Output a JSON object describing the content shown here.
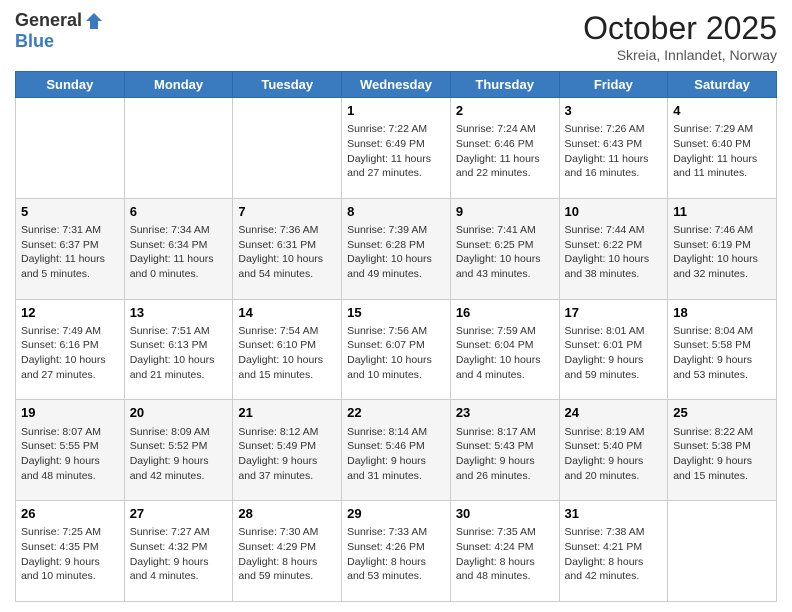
{
  "logo": {
    "general": "General",
    "blue": "Blue"
  },
  "header": {
    "month": "October 2025",
    "location": "Skreia, Innlandet, Norway"
  },
  "days": [
    "Sunday",
    "Monday",
    "Tuesday",
    "Wednesday",
    "Thursday",
    "Friday",
    "Saturday"
  ],
  "weeks": [
    [
      {
        "day": "",
        "info": ""
      },
      {
        "day": "",
        "info": ""
      },
      {
        "day": "",
        "info": ""
      },
      {
        "day": "1",
        "info": "Sunrise: 7:22 AM\nSunset: 6:49 PM\nDaylight: 11 hours and 27 minutes."
      },
      {
        "day": "2",
        "info": "Sunrise: 7:24 AM\nSunset: 6:46 PM\nDaylight: 11 hours and 22 minutes."
      },
      {
        "day": "3",
        "info": "Sunrise: 7:26 AM\nSunset: 6:43 PM\nDaylight: 11 hours and 16 minutes."
      },
      {
        "day": "4",
        "info": "Sunrise: 7:29 AM\nSunset: 6:40 PM\nDaylight: 11 hours and 11 minutes."
      }
    ],
    [
      {
        "day": "5",
        "info": "Sunrise: 7:31 AM\nSunset: 6:37 PM\nDaylight: 11 hours and 5 minutes."
      },
      {
        "day": "6",
        "info": "Sunrise: 7:34 AM\nSunset: 6:34 PM\nDaylight: 11 hours and 0 minutes."
      },
      {
        "day": "7",
        "info": "Sunrise: 7:36 AM\nSunset: 6:31 PM\nDaylight: 10 hours and 54 minutes."
      },
      {
        "day": "8",
        "info": "Sunrise: 7:39 AM\nSunset: 6:28 PM\nDaylight: 10 hours and 49 minutes."
      },
      {
        "day": "9",
        "info": "Sunrise: 7:41 AM\nSunset: 6:25 PM\nDaylight: 10 hours and 43 minutes."
      },
      {
        "day": "10",
        "info": "Sunrise: 7:44 AM\nSunset: 6:22 PM\nDaylight: 10 hours and 38 minutes."
      },
      {
        "day": "11",
        "info": "Sunrise: 7:46 AM\nSunset: 6:19 PM\nDaylight: 10 hours and 32 minutes."
      }
    ],
    [
      {
        "day": "12",
        "info": "Sunrise: 7:49 AM\nSunset: 6:16 PM\nDaylight: 10 hours and 27 minutes."
      },
      {
        "day": "13",
        "info": "Sunrise: 7:51 AM\nSunset: 6:13 PM\nDaylight: 10 hours and 21 minutes."
      },
      {
        "day": "14",
        "info": "Sunrise: 7:54 AM\nSunset: 6:10 PM\nDaylight: 10 hours and 15 minutes."
      },
      {
        "day": "15",
        "info": "Sunrise: 7:56 AM\nSunset: 6:07 PM\nDaylight: 10 hours and 10 minutes."
      },
      {
        "day": "16",
        "info": "Sunrise: 7:59 AM\nSunset: 6:04 PM\nDaylight: 10 hours and 4 minutes."
      },
      {
        "day": "17",
        "info": "Sunrise: 8:01 AM\nSunset: 6:01 PM\nDaylight: 9 hours and 59 minutes."
      },
      {
        "day": "18",
        "info": "Sunrise: 8:04 AM\nSunset: 5:58 PM\nDaylight: 9 hours and 53 minutes."
      }
    ],
    [
      {
        "day": "19",
        "info": "Sunrise: 8:07 AM\nSunset: 5:55 PM\nDaylight: 9 hours and 48 minutes."
      },
      {
        "day": "20",
        "info": "Sunrise: 8:09 AM\nSunset: 5:52 PM\nDaylight: 9 hours and 42 minutes."
      },
      {
        "day": "21",
        "info": "Sunrise: 8:12 AM\nSunset: 5:49 PM\nDaylight: 9 hours and 37 minutes."
      },
      {
        "day": "22",
        "info": "Sunrise: 8:14 AM\nSunset: 5:46 PM\nDaylight: 9 hours and 31 minutes."
      },
      {
        "day": "23",
        "info": "Sunrise: 8:17 AM\nSunset: 5:43 PM\nDaylight: 9 hours and 26 minutes."
      },
      {
        "day": "24",
        "info": "Sunrise: 8:19 AM\nSunset: 5:40 PM\nDaylight: 9 hours and 20 minutes."
      },
      {
        "day": "25",
        "info": "Sunrise: 8:22 AM\nSunset: 5:38 PM\nDaylight: 9 hours and 15 minutes."
      }
    ],
    [
      {
        "day": "26",
        "info": "Sunrise: 7:25 AM\nSunset: 4:35 PM\nDaylight: 9 hours and 10 minutes."
      },
      {
        "day": "27",
        "info": "Sunrise: 7:27 AM\nSunset: 4:32 PM\nDaylight: 9 hours and 4 minutes."
      },
      {
        "day": "28",
        "info": "Sunrise: 7:30 AM\nSunset: 4:29 PM\nDaylight: 8 hours and 59 minutes."
      },
      {
        "day": "29",
        "info": "Sunrise: 7:33 AM\nSunset: 4:26 PM\nDaylight: 8 hours and 53 minutes."
      },
      {
        "day": "30",
        "info": "Sunrise: 7:35 AM\nSunset: 4:24 PM\nDaylight: 8 hours and 48 minutes."
      },
      {
        "day": "31",
        "info": "Sunrise: 7:38 AM\nSunset: 4:21 PM\nDaylight: 8 hours and 42 minutes."
      },
      {
        "day": "",
        "info": ""
      }
    ]
  ]
}
